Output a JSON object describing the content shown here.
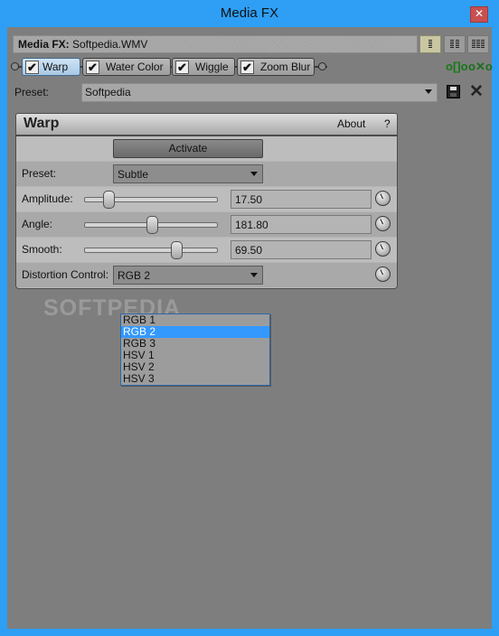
{
  "window": {
    "title": "Media FX",
    "close_glyph": "✕"
  },
  "header": {
    "label": "Media FX:",
    "file": "Softpedia.WMV"
  },
  "fx_chain": [
    {
      "label": "Warp",
      "checked": true,
      "selected": true
    },
    {
      "label": "Water Color",
      "checked": true,
      "selected": false
    },
    {
      "label": "Wiggle",
      "checked": true,
      "selected": false
    },
    {
      "label": "Zoom Blur",
      "checked": true,
      "selected": false
    }
  ],
  "check_glyph": "✔",
  "toolbar_icons": {
    "view_list": "list-view-icon",
    "view_two_col": "two-column-view-icon",
    "view_three_col": "three-column-view-icon",
    "chain_add": "plug-in-chain-icon",
    "chain_remove": "remove-plug-in-icon",
    "chain_add_glyph": "o[]o",
    "chain_remove_glyph": "o✕o"
  },
  "preset": {
    "label": "Preset:",
    "value": "Softpedia"
  },
  "delete_glyph": "✕",
  "plugin": {
    "name": "Warp",
    "about": "About",
    "help": "?",
    "activate": "Activate",
    "preset_label": "Preset:",
    "preset_value": "Subtle",
    "amplitude": {
      "label": "Amplitude:",
      "value": "17.50",
      "fraction": 0.175
    },
    "angle": {
      "label": "Angle:",
      "value": "181.80",
      "fraction": 0.505
    },
    "smooth": {
      "label": "Smooth:",
      "value": "69.50",
      "fraction": 0.695
    },
    "distortion": {
      "label": "Distortion Control:",
      "value": "RGB 2",
      "options": [
        "RGB 1",
        "RGB 2",
        "RGB 3",
        "HSV 1",
        "HSV 2",
        "HSV 3"
      ],
      "selected_index": 1
    }
  },
  "watermark": "SOFTPEDIA",
  "colors": {
    "accent": "#2e9ff5",
    "selection": "#3399ff",
    "background": "#7e7e7e"
  }
}
